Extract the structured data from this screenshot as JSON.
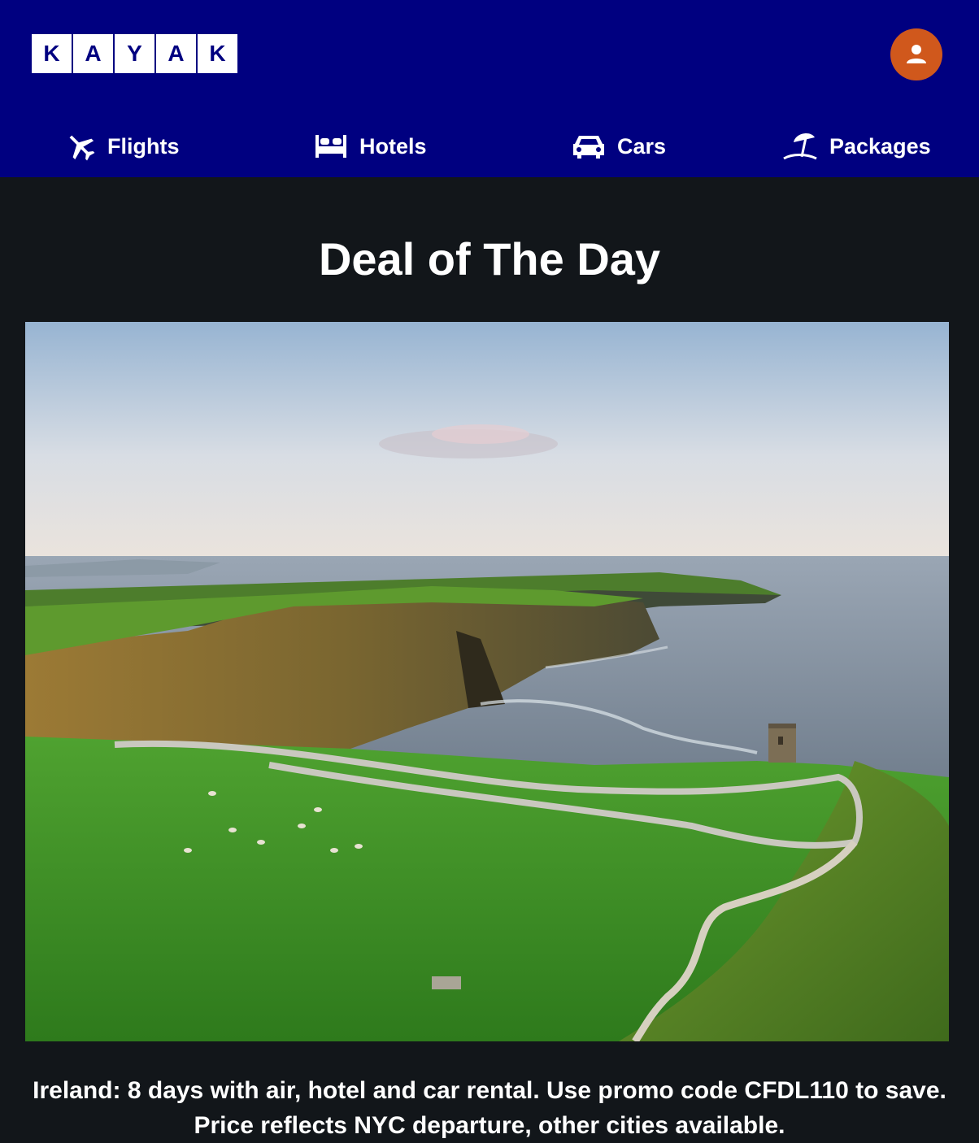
{
  "header": {
    "logo_letters": [
      "K",
      "A",
      "Y",
      "A",
      "K"
    ],
    "profile_icon": "user-icon",
    "colors": {
      "background": "#000080",
      "avatar": "#d0581c"
    }
  },
  "nav": {
    "items": [
      {
        "label": "Flights",
        "icon": "airplane-icon"
      },
      {
        "label": "Hotels",
        "icon": "bed-icon"
      },
      {
        "label": "Cars",
        "icon": "car-icon"
      },
      {
        "label": "Packages",
        "icon": "beach-umbrella-icon"
      }
    ]
  },
  "main": {
    "title": "Deal of The Day",
    "description": "Ireland: 8 days with air, hotel and car rental. Use promo code CFDL110 to save. Price reflects NYC departure, other cities available."
  }
}
